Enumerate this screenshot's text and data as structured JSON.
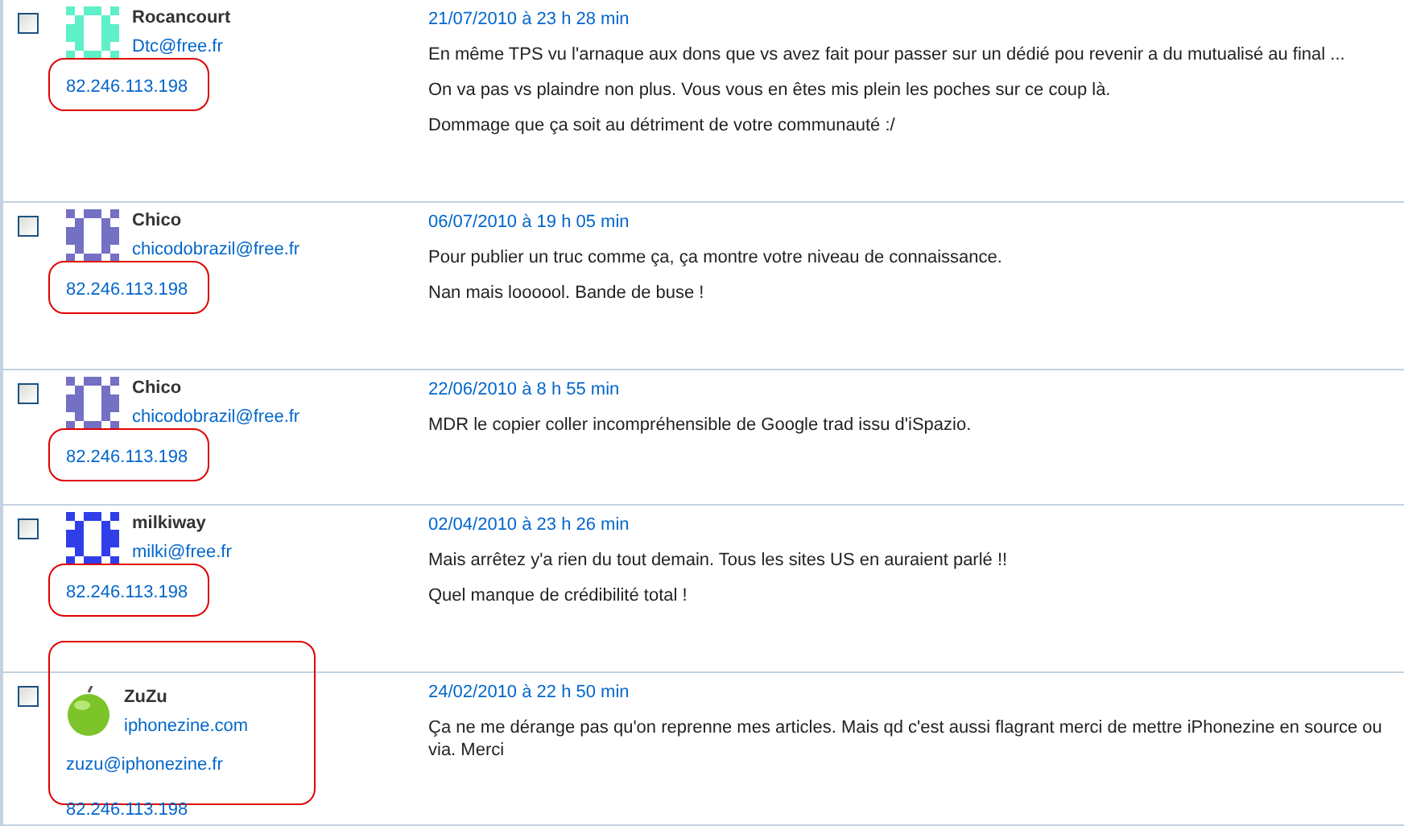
{
  "comments": [
    {
      "checked": false,
      "author": {
        "name": "Rocancourt",
        "avatar": {
          "kind": "identicon",
          "color": "#5ef0c8"
        },
        "links": [
          "Dtc@free.fr"
        ],
        "ip": "82.246.113.198",
        "ip_circled": true,
        "author_circled": false
      },
      "date": "21/07/2010 à 23 h 28 min",
      "paragraphs": [
        "En même TPS vu l'arnaque aux dons que vs avez fait pour passer sur un dédié pou revenir a du mutualisé au final ...",
        "On va pas vs plaindre non plus. Vous vous en êtes mis plein les poches sur ce coup là.",
        "Dommage que ça soit au détriment de votre communauté :/"
      ]
    },
    {
      "checked": false,
      "author": {
        "name": "Chico",
        "avatar": {
          "kind": "identicon",
          "color": "#7470c4"
        },
        "links": [
          "chicodobrazil@free.fr"
        ],
        "ip": "82.246.113.198",
        "ip_circled": true,
        "author_circled": false
      },
      "date": "06/07/2010 à 19 h 05 min",
      "paragraphs": [
        "Pour publier un truc comme ça, ça montre votre niveau de connaissance.",
        "Nan mais loooool. Bande de buse !"
      ]
    },
    {
      "checked": false,
      "author": {
        "name": "Chico",
        "avatar": {
          "kind": "identicon",
          "color": "#7470c4"
        },
        "links": [
          "chicodobrazil@free.fr"
        ],
        "ip": "82.246.113.198",
        "ip_circled": true,
        "author_circled": false
      },
      "date": "22/06/2010 à 8 h 55 min",
      "paragraphs": [
        "MDR le copier coller incompréhensible de Google trad issu d'iSpazio."
      ]
    },
    {
      "checked": false,
      "author": {
        "name": "milkiway",
        "avatar": {
          "kind": "identicon",
          "color": "#2f3ee8"
        },
        "links": [
          "milki@free.fr"
        ],
        "ip": "82.246.113.198",
        "ip_circled": true,
        "author_circled": false
      },
      "date": "02/04/2010 à 23 h 26 min",
      "paragraphs": [
        "Mais arrêtez y'a rien du tout demain. Tous les sites US en auraient parlé !!",
        "Quel manque de crédibilité total !"
      ]
    },
    {
      "checked": false,
      "author": {
        "name": "ZuZu",
        "avatar": {
          "kind": "apple"
        },
        "links": [
          "iphonezine.com",
          "zuzu@iphonezine.fr"
        ],
        "ip": "82.246.113.198",
        "ip_circled": false,
        "author_circled": true
      },
      "date": "24/02/2010 à 22 h 50 min",
      "paragraphs": [
        "Ça ne me dérange pas qu'on reprenne mes articles. Mais qd c'est aussi flagrant merci de mettre iPhonezine en source ou via. Merci"
      ]
    }
  ]
}
